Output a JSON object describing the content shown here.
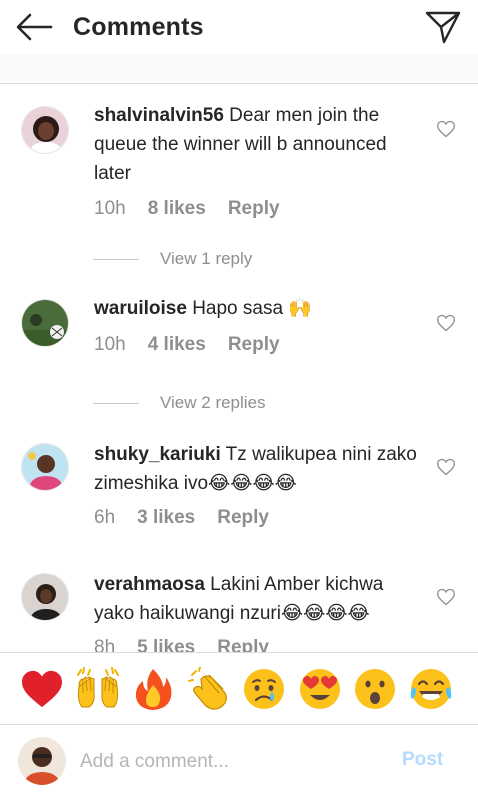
{
  "header": {
    "title": "Comments",
    "back_icon": "arrow-left-icon",
    "send_icon": "paper-plane-icon"
  },
  "comments": [
    {
      "username": "shalvinalvin56",
      "text": " Dear men join the queue the winner will b announced later",
      "time": "10h",
      "likes": "8 likes",
      "reply": "Reply",
      "view_replies": "View 1 reply"
    },
    {
      "username": "waruiloise",
      "text": " Hapo sasa 🙌",
      "time": "10h",
      "likes": "4 likes",
      "reply": "Reply",
      "view_replies": "View 2 replies"
    },
    {
      "username": "shuky_kariuki",
      "text": " Tz walikupea nini zako zimeshika ivo😂😂😂😂",
      "time": "6h",
      "likes": "3 likes",
      "reply": "Reply"
    },
    {
      "username": "verahmaosa",
      "text": " Lakini Amber kichwa yako haikuwangi nzuri😂😂😂😂",
      "time": "8h",
      "likes": "5 likes",
      "reply": "Reply"
    }
  ],
  "quick_emojis": [
    "❤️",
    "🙌",
    "🔥",
    "👏",
    "😢",
    "😍",
    "😮",
    "😂"
  ],
  "composer": {
    "placeholder": "Add a comment...",
    "post_label": "Post"
  },
  "colors": {
    "text": "#262626",
    "muted": "#8e8e8e",
    "post_disabled": "#b3dbff",
    "divider": "#dbdbdb"
  }
}
